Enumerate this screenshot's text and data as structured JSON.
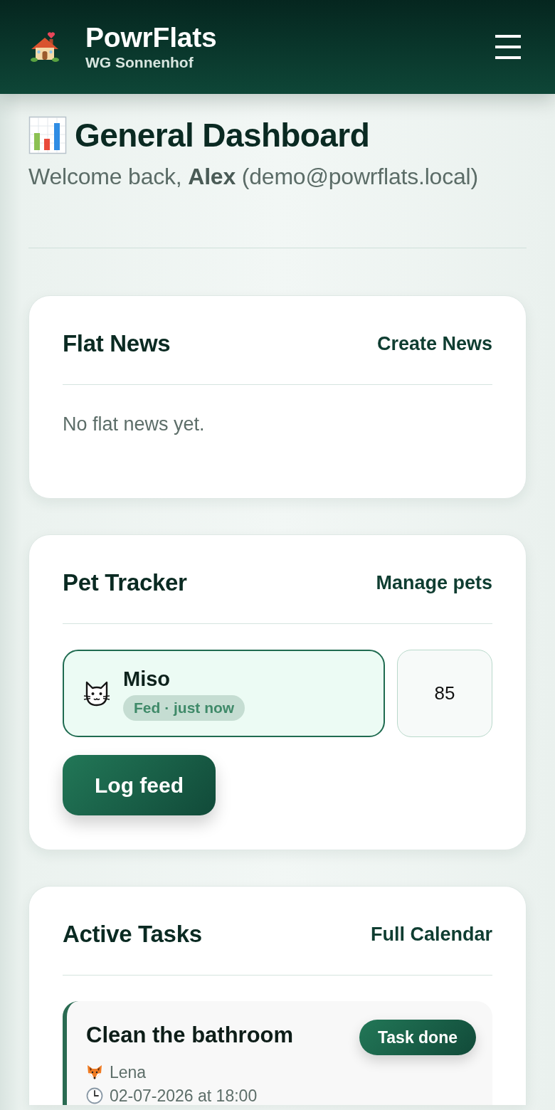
{
  "header": {
    "app_name": "PowrFlats",
    "flat_name": "WG Sonnenhof"
  },
  "intro": {
    "title": "General Dashboard",
    "welcome": "Welcome back, **Alex** (demo@powrflats.local)"
  },
  "cards": [
    {
      "kind": "news",
      "title": "Flat News",
      "action": "Create News",
      "empty_text": "No flat news yet."
    },
    {
      "kind": "pets",
      "title": "Pet Tracker",
      "action": "Manage pets",
      "pets": [
        {
          "name": "Miso",
          "status": "Fed · just now",
          "fed": true
        }
      ],
      "amount_field": {
        "value": "85"
      },
      "button": "Log feed"
    },
    {
      "kind": "tasks",
      "title": "Active Tasks",
      "action": "Full Calendar",
      "tasks": [
        {
          "title": "Clean the bathroom",
          "button": "Task done",
          "assignee": "Lena",
          "due": "02-07-2026 at 18:00"
        }
      ]
    }
  ]
}
